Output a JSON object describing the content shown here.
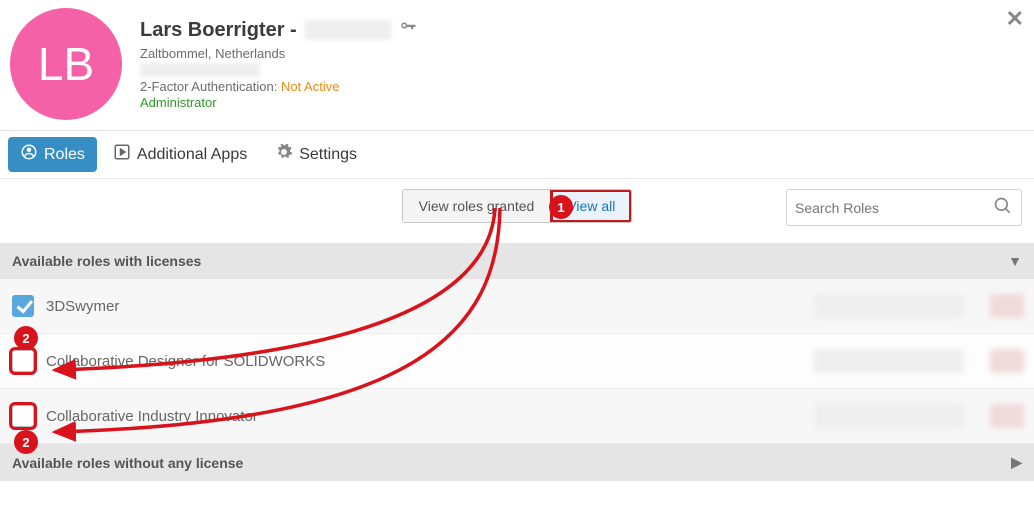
{
  "close_symbol": "✕",
  "user": {
    "initials": "LB",
    "name_prefix": "Lars Boerrigter -",
    "location": "Zaltbommel, Netherlands",
    "tfa_label": "2-Factor Authentication:",
    "tfa_status": "Not Active",
    "admin_label": "Administrator"
  },
  "tabs": {
    "roles": "Roles",
    "apps": "Additional Apps",
    "settings": "Settings"
  },
  "toolbar": {
    "view_granted": "View roles granted",
    "view_all": "View all",
    "search_placeholder": "Search Roles"
  },
  "callouts": {
    "one": "1",
    "two_a": "2",
    "two_b": "2"
  },
  "sections": {
    "with_licenses": "Available roles with licenses",
    "without_licenses": "Available roles without any license"
  },
  "roles": [
    {
      "label": "3DSwymer"
    },
    {
      "label": "Collaborative Designer for SOLIDWORKS"
    },
    {
      "label": "Collaborative Industry Innovator"
    }
  ]
}
